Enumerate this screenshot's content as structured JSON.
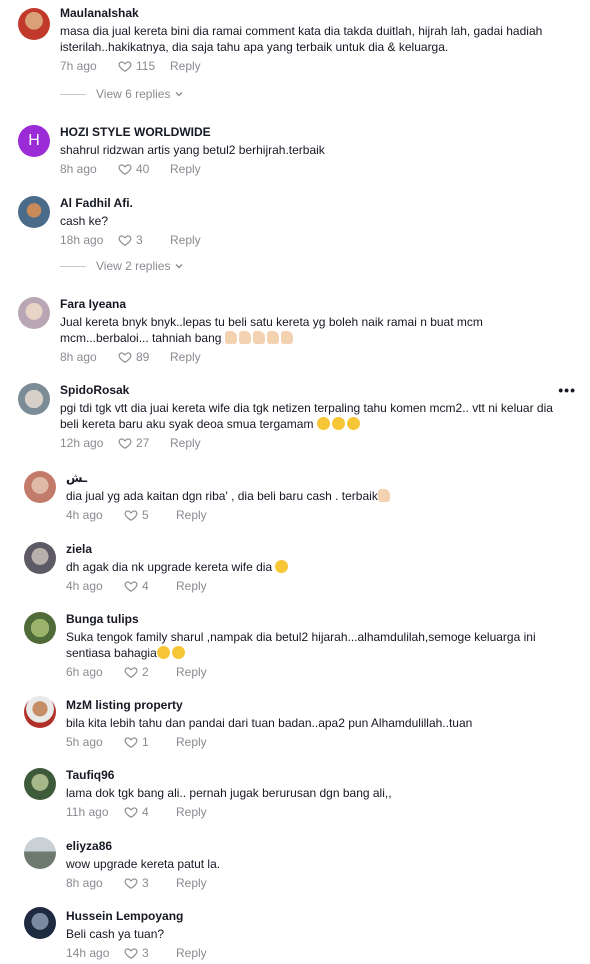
{
  "comments": [
    {
      "name": "MaulanaIshak",
      "text": "masa dia jual kereta bini dia ramai comment kata dia takda duitlah, hijrah lah, gadai hadiah isterilah..hakikatnya, dia saja tahu apa yang terbaik untuk dia & keluarga.",
      "time": "7h ago",
      "likes": "115",
      "reply": "Reply",
      "replies_label": "View 6 replies"
    },
    {
      "name": "HOZI STYLE WORLDWIDE",
      "avatar_letter": "H",
      "text": "shahrul ridzwan artis yang betul2 berhijrah.terbaik",
      "time": "8h ago",
      "likes": "40",
      "reply": "Reply"
    },
    {
      "name": "Al Fadhil Afi.",
      "text": "cash ke?",
      "time": "18h ago",
      "likes": "3",
      "reply": "Reply",
      "replies_label": "View 2 replies"
    },
    {
      "name": "Fara Iyeana",
      "text": "Jual kereta bnyk bnyk..lepas tu beli satu kereta yg boleh naik ramai n buat mcm mcm...berbaloi... tahniah bang",
      "time": "8h ago",
      "likes": "89",
      "reply": "Reply"
    },
    {
      "name": "SpidoRosak",
      "text": "pgi tdi tgk vtt dia juai kereta wife dia tgk netizen terpaling tahu komen mcm2.. vtt ni keluar dia beli kereta baru aku syak deoa smua tergamam",
      "time": "12h ago",
      "likes": "27",
      "reply": "Reply",
      "more": "•••"
    },
    {
      "name": "ـش",
      "text": "dia jual yg ada kaitan dgn riba' , dia beli baru cash . terbaik",
      "time": "4h ago",
      "likes": "5",
      "reply": "Reply"
    },
    {
      "name": "ziela",
      "text": "dh agak dia nk upgrade kereta wife dia",
      "time": "4h ago",
      "likes": "4",
      "reply": "Reply"
    },
    {
      "name": "Bunga tulips",
      "text": "Suka tengok family sharul ,nampak dia betul2 hijarah...alhamdulilah,semoge keluarga ini sentiasa bahagia",
      "time": "6h ago",
      "likes": "2",
      "reply": "Reply"
    },
    {
      "name": "MzM listing property",
      "text": "bila kita lebih tahu dan pandai dari tuan badan..apa2 pun Alhamdulillah..tuan",
      "time": "5h ago",
      "likes": "1",
      "reply": "Reply"
    },
    {
      "name": "Taufiq96",
      "text": "lama dok tgk bang ali.. pernah jugak berurusan dgn bang ali,,",
      "time": "11h ago",
      "likes": "4",
      "reply": "Reply"
    },
    {
      "name": "eliyza86",
      "text": "wow upgrade kereta patut la.",
      "time": "8h ago",
      "likes": "3",
      "reply": "Reply"
    },
    {
      "name": "Hussein Lempoyang",
      "text": "Beli cash ya tuan?",
      "time": "14h ago",
      "likes": "3",
      "reply": "Reply"
    }
  ],
  "colors": {
    "name": "#161823",
    "secondary": "#8a8b91",
    "hozi_avatar": "#9b2bd6"
  }
}
